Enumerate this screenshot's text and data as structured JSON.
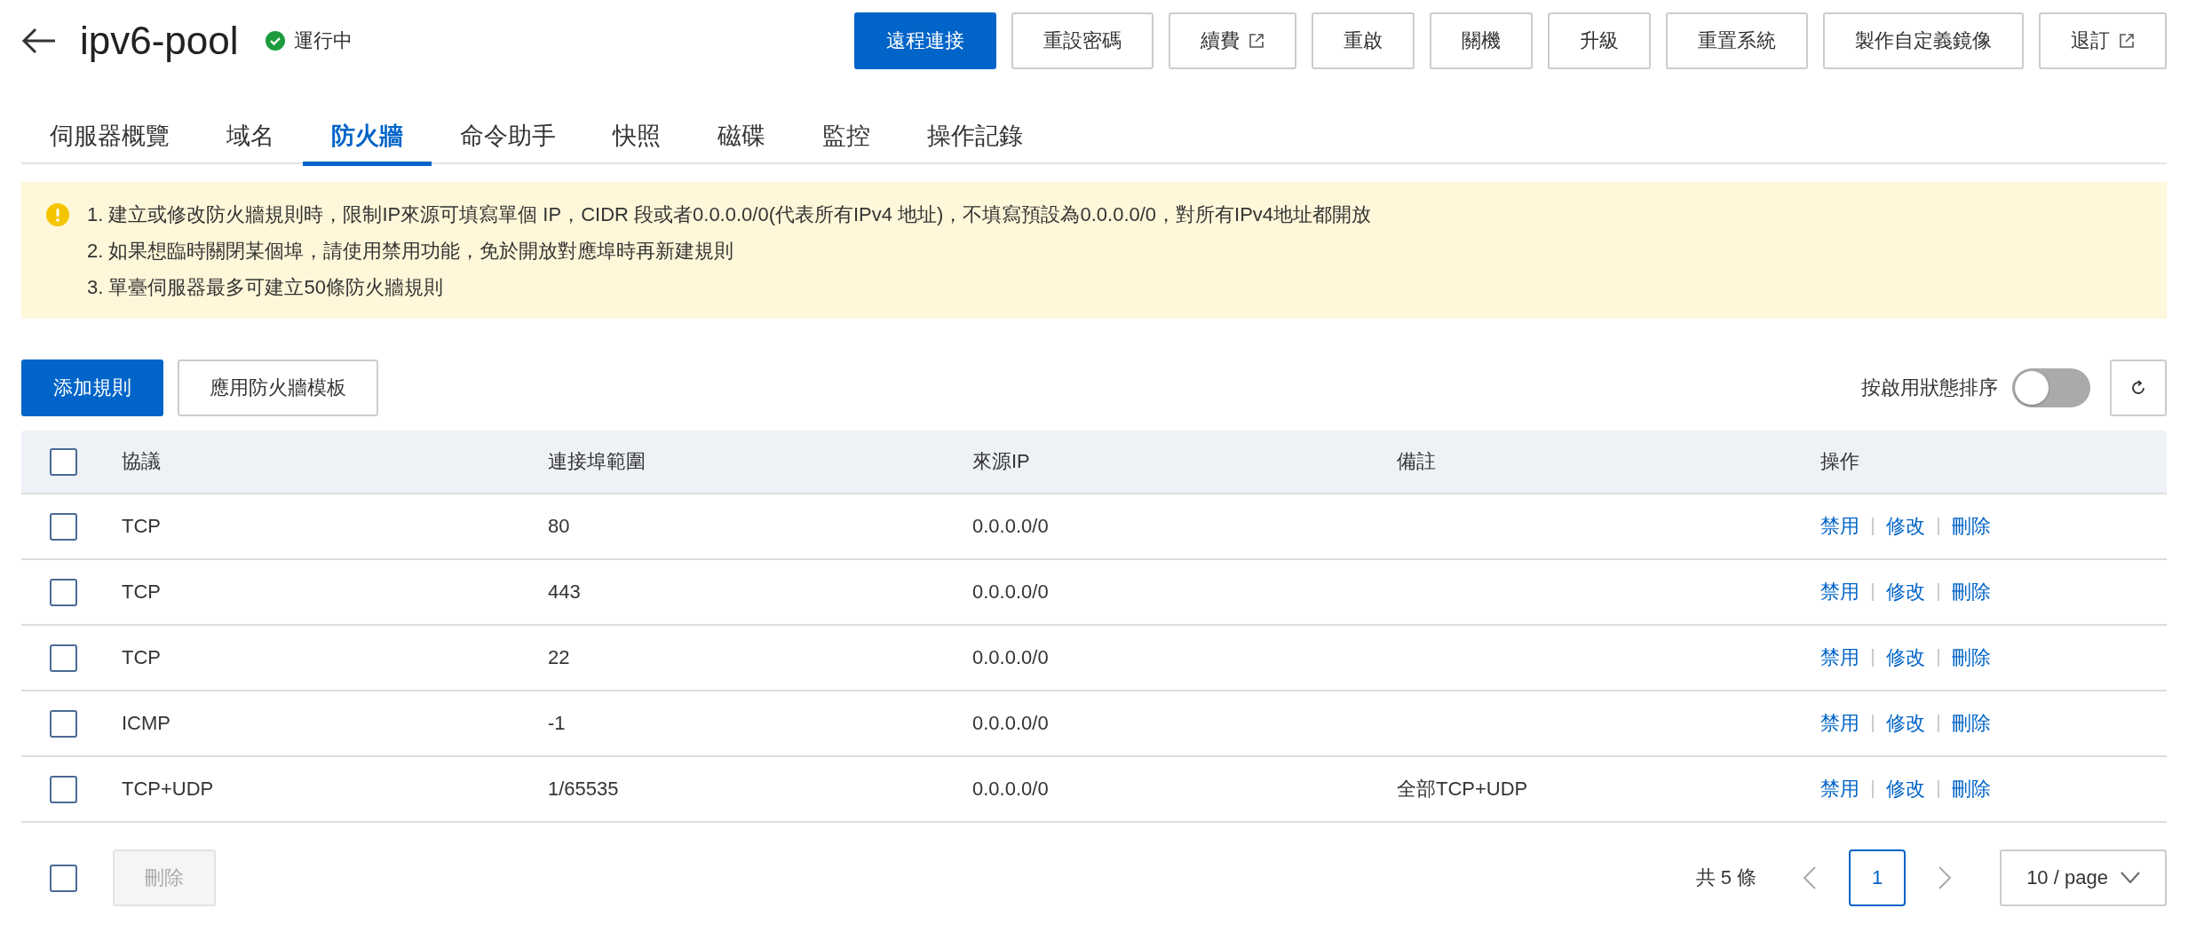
{
  "header": {
    "title": "ipv6-pool",
    "status": {
      "label": "運行中",
      "kind": "running"
    },
    "buttons": [
      {
        "label": "遠程連接",
        "primary": true,
        "external": false
      },
      {
        "label": "重設密碼",
        "primary": false,
        "external": false
      },
      {
        "label": "續費",
        "primary": false,
        "external": true
      },
      {
        "label": "重啟",
        "primary": false,
        "external": false
      },
      {
        "label": "關機",
        "primary": false,
        "external": false
      },
      {
        "label": "升級",
        "primary": false,
        "external": false
      },
      {
        "label": "重置系統",
        "primary": false,
        "external": false
      },
      {
        "label": "製作自定義鏡像",
        "primary": false,
        "external": false
      },
      {
        "label": "退訂",
        "primary": false,
        "external": true
      }
    ]
  },
  "tabs": [
    {
      "label": "伺服器概覽",
      "selected": false
    },
    {
      "label": "域名",
      "selected": false
    },
    {
      "label": "防火牆",
      "selected": true
    },
    {
      "label": "命令助手",
      "selected": false
    },
    {
      "label": "快照",
      "selected": false
    },
    {
      "label": "磁碟",
      "selected": false
    },
    {
      "label": "監控",
      "selected": false
    },
    {
      "label": "操作記錄",
      "selected": false
    }
  ],
  "notice": {
    "lines": [
      "1. 建立或修改防火牆規則時，限制IP來源可填寫單個 IP，CIDR 段或者0.0.0.0/0(代表所有IPv4 地址)，不填寫預設為0.0.0.0/0，對所有IPv4地址都開放",
      "2. 如果想臨時關閉某個埠，請使用禁用功能，免於開放對應埠時再新建規則",
      "3. 單臺伺服器最多可建立50條防火牆規則"
    ]
  },
  "toolbar": {
    "add_button": "添加規則",
    "template_button": "應用防火牆模板",
    "sort_toggle": {
      "label": "按啟用狀態排序",
      "on": false
    }
  },
  "table": {
    "select_all": false,
    "columns": [
      "協議",
      "連接埠範圍",
      "來源IP",
      "備註",
      "操作"
    ],
    "rows": [
      {
        "checked": false,
        "cells": [
          "TCP",
          "80",
          "0.0.0.0/0",
          ""
        ],
        "actions": [
          "禁用",
          "修改",
          "刪除"
        ]
      },
      {
        "checked": false,
        "cells": [
          "TCP",
          "443",
          "0.0.0.0/0",
          ""
        ],
        "actions": [
          "禁用",
          "修改",
          "刪除"
        ]
      },
      {
        "checked": false,
        "cells": [
          "TCP",
          "22",
          "0.0.0.0/0",
          ""
        ],
        "actions": [
          "禁用",
          "修改",
          "刪除"
        ]
      },
      {
        "checked": false,
        "cells": [
          "ICMP",
          "-1",
          "0.0.0.0/0",
          ""
        ],
        "actions": [
          "禁用",
          "修改",
          "刪除"
        ]
      },
      {
        "checked": false,
        "cells": [
          "TCP+UDP",
          "1/65535",
          "0.0.0.0/0",
          "全部TCP+UDP"
        ],
        "actions": [
          "禁用",
          "修改",
          "刪除"
        ]
      }
    ]
  },
  "footer": {
    "select_all": false,
    "delete_button": {
      "label": "刪除",
      "disabled": true
    },
    "total": "共 5 條",
    "pages": [
      {
        "label": "1",
        "selected": true
      }
    ],
    "page_size": "10 / page"
  }
}
